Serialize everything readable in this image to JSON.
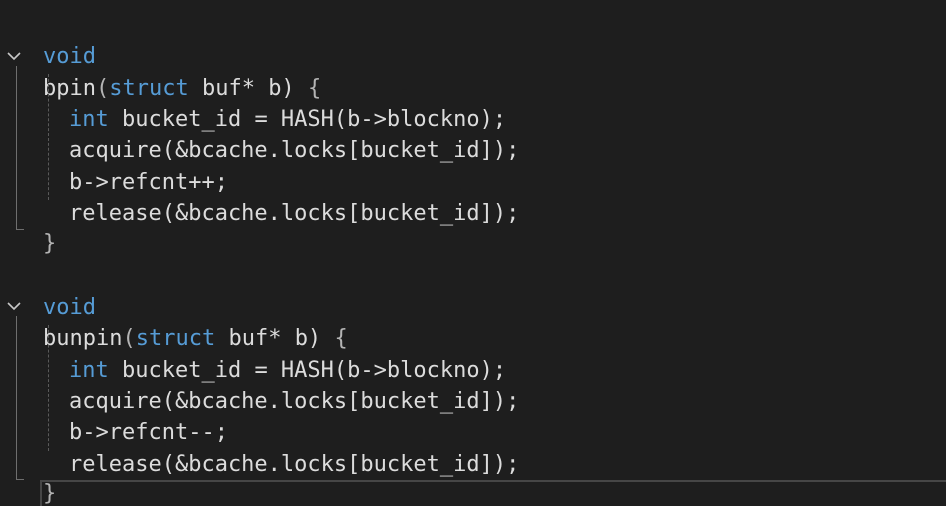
{
  "functions": [
    {
      "return_type": "void",
      "name": "bpin",
      "open_paren": "(",
      "param_kw": "struct",
      "param_rest": " buf* b) ",
      "open_brace": "{",
      "body": [
        {
          "type_kw": "int",
          "text": " bucket_id = HASH(b->blockno);"
        },
        {
          "type_kw": "",
          "text": "acquire(&bcache.locks[bucket_id]);"
        },
        {
          "type_kw": "",
          "text": "b->refcnt++;"
        },
        {
          "type_kw": "",
          "text": "release(&bcache.locks[bucket_id]);"
        }
      ],
      "close_brace": "}"
    },
    {
      "return_type": "void",
      "name": "bunpin",
      "open_paren": "(",
      "param_kw": "struct",
      "param_rest": " buf* b) ",
      "open_brace": "{",
      "body": [
        {
          "type_kw": "int",
          "text": " bucket_id = HASH(b->blockno);"
        },
        {
          "type_kw": "",
          "text": "acquire(&bcache.locks[bucket_id]);"
        },
        {
          "type_kw": "",
          "text": "b->refcnt--;"
        },
        {
          "type_kw": "",
          "text": "release(&bcache.locks[bucket_id]);"
        }
      ],
      "close_brace": "}"
    }
  ],
  "colors": {
    "background": "#1e1e1e",
    "keyword": "#569cd6",
    "identifier": "#dcdcdc",
    "guide": "#6e6e6e"
  },
  "icons": {
    "fold": "chevron-down-icon"
  }
}
